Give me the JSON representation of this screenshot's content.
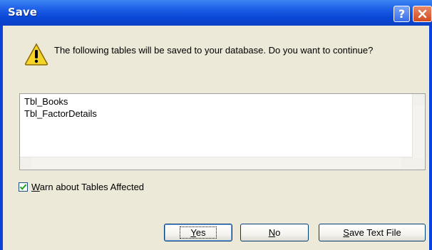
{
  "window": {
    "title": "Save",
    "help_button": "?",
    "close_button": "X"
  },
  "dialog": {
    "icon": "warning-icon",
    "message": "The following tables will be saved to your database. Do you want to continue?"
  },
  "tables_list": {
    "items": [
      "Tbl_Books",
      "Tbl_FactorDetails"
    ]
  },
  "warn_checkbox": {
    "checked": true,
    "label_accel": "W",
    "label_rest": "arn about Tables Affected"
  },
  "buttons": {
    "yes_accel": "Y",
    "yes_rest": "es",
    "no_accel": "N",
    "no_rest": "o",
    "save_accel": "S",
    "save_rest": "ave Text File"
  },
  "colors": {
    "titlebar": "#0a46d6",
    "dialog_bg": "#ece9d8",
    "close_button": "#d24a1e",
    "warning_yellow": "#f5d42a"
  }
}
